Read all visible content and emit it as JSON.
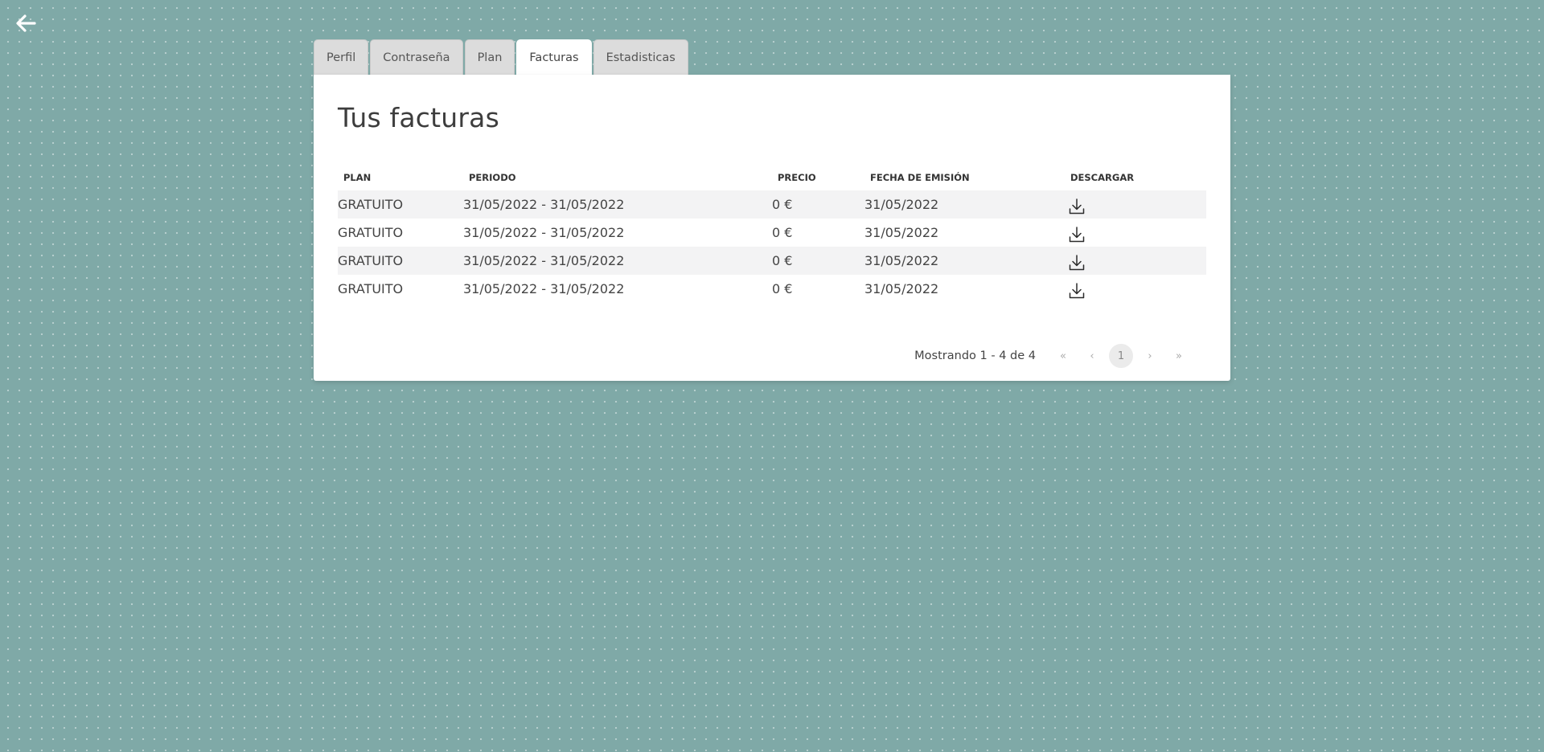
{
  "nav": {
    "back_icon": "arrow-left-icon"
  },
  "tabs": [
    {
      "label": "Perfil",
      "active": false
    },
    {
      "label": "Contraseña",
      "active": false
    },
    {
      "label": "Plan",
      "active": false
    },
    {
      "label": "Facturas",
      "active": true
    },
    {
      "label": "Estadisticas",
      "active": false
    }
  ],
  "panel": {
    "title": "Tus facturas"
  },
  "table": {
    "headers": {
      "plan": "PLAN",
      "periodo": "PERIODO",
      "precio": "PRECIO",
      "fecha": "FECHA DE EMISIÓN",
      "descargar": "DESCARGAR"
    },
    "rows": [
      {
        "plan": "GRATUITO",
        "periodo": "31/05/2022 - 31/05/2022",
        "precio": "0 €",
        "fecha": "31/05/2022",
        "download_icon": "download-icon"
      },
      {
        "plan": "GRATUITO",
        "periodo": "31/05/2022 - 31/05/2022",
        "precio": "0 €",
        "fecha": "31/05/2022",
        "download_icon": "download-icon"
      },
      {
        "plan": "GRATUITO",
        "periodo": "31/05/2022 - 31/05/2022",
        "precio": "0 €",
        "fecha": "31/05/2022",
        "download_icon": "download-icon"
      },
      {
        "plan": "GRATUITO",
        "periodo": "31/05/2022 - 31/05/2022",
        "precio": "0 €",
        "fecha": "31/05/2022",
        "download_icon": "download-icon"
      }
    ]
  },
  "pagination": {
    "info": "Mostrando 1 - 4 de 4",
    "first": "«",
    "prev": "‹",
    "current_page": "1",
    "next": "›",
    "last": "»"
  },
  "colors": {
    "background": "#7fa9a7",
    "panel": "#ffffff",
    "row_stripe": "#f3f3f4",
    "tab_inactive": "#dcdcdc"
  }
}
